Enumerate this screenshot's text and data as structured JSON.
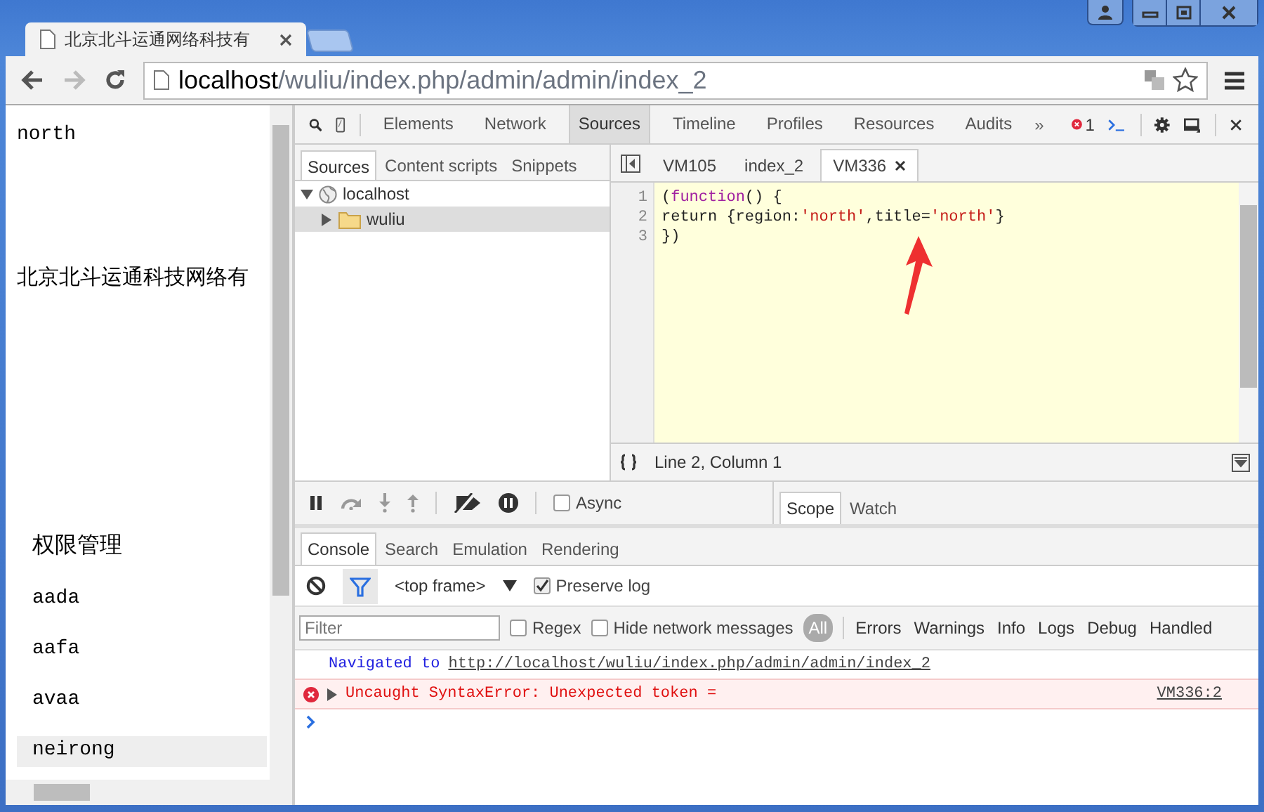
{
  "browser_tabs": [
    {
      "title": "北京北斗运通网络科技有",
      "selected": true
    }
  ],
  "address_bar": {
    "host": "localhost",
    "path": "/wuliu/index.php/admin/admin/index_2"
  },
  "page": {
    "heading": "north",
    "company": "北京北斗运通科技网络有",
    "menu_title": "权限管理",
    "menu": [
      {
        "label": "aada",
        "selected": false
      },
      {
        "label": "aafa",
        "selected": false
      },
      {
        "label": "avaa",
        "selected": false
      },
      {
        "label": "neirong",
        "selected": true
      }
    ]
  },
  "devtools": {
    "panels": [
      {
        "label": "Elements",
        "selected": false
      },
      {
        "label": "Network",
        "selected": false
      },
      {
        "label": "Sources",
        "selected": true
      },
      {
        "label": "Timeline",
        "selected": false
      },
      {
        "label": "Profiles",
        "selected": false
      },
      {
        "label": "Resources",
        "selected": false
      },
      {
        "label": "Audits",
        "selected": false
      }
    ],
    "more": "»",
    "error_count": "1",
    "navigator_tabs": [
      {
        "label": "Sources",
        "selected": true
      },
      {
        "label": "Content scripts",
        "selected": false
      },
      {
        "label": "Snippets",
        "selected": false
      }
    ],
    "tree": [
      {
        "label": "localhost",
        "kind": "host",
        "expanded": true,
        "selected": false,
        "children": [
          {
            "label": "wuliu",
            "kind": "folder",
            "expanded": false,
            "selected": true
          }
        ]
      }
    ],
    "editor_tabs": [
      {
        "label": "VM105",
        "selected": false,
        "closable": false
      },
      {
        "label": "index_2",
        "selected": false,
        "closable": false
      },
      {
        "label": "VM336",
        "selected": true,
        "closable": true
      }
    ],
    "code": [
      {
        "number": "1",
        "tokens": [
          {
            "kind": "plain",
            "text": "("
          },
          {
            "kind": "keyword",
            "text": "function"
          },
          {
            "kind": "plain",
            "text": "() {"
          }
        ]
      },
      {
        "number": "2",
        "tokens": [
          {
            "kind": "plain",
            "text": "return {region:"
          },
          {
            "kind": "string",
            "text": "'north'"
          },
          {
            "kind": "plain",
            "text": ",title="
          },
          {
            "kind": "string",
            "text": "'north'"
          },
          {
            "kind": "plain",
            "text": "}"
          }
        ]
      },
      {
        "number": "3",
        "tokens": [
          {
            "kind": "plain",
            "text": "})"
          }
        ]
      }
    ],
    "status": "Line 2, Column 1",
    "async": {
      "label": "Async",
      "checked": false
    },
    "sidebar_tabs": [
      {
        "label": "Scope",
        "selected": true
      },
      {
        "label": "Watch",
        "selected": false
      }
    ],
    "drawer_tabs": [
      {
        "label": "Console",
        "selected": true
      },
      {
        "label": "Search",
        "selected": false
      },
      {
        "label": "Emulation",
        "selected": false
      },
      {
        "label": "Rendering",
        "selected": false
      }
    ],
    "context": "<top frame>",
    "preserve_log": {
      "label": "Preserve log",
      "checked": true
    },
    "filter": {
      "placeholder": "Filter"
    },
    "regex": {
      "label": "Regex",
      "checked": false
    },
    "hide_network": {
      "label": "Hide network messages",
      "checked": false
    },
    "levels": [
      {
        "label": "All",
        "selected": true
      },
      {
        "label": "Errors",
        "selected": false
      },
      {
        "label": "Warnings",
        "selected": false
      },
      {
        "label": "Info",
        "selected": false
      },
      {
        "label": "Logs",
        "selected": false
      },
      {
        "label": "Debug",
        "selected": false
      },
      {
        "label": "Handled",
        "selected": false
      }
    ],
    "messages": [
      {
        "kind": "info",
        "text": "Navigated to",
        "link": "http://localhost/wuliu/index.php/admin/admin/index_2"
      },
      {
        "kind": "error",
        "text": "Uncaught SyntaxError: Unexpected token =",
        "source": "VM336:2"
      }
    ]
  }
}
